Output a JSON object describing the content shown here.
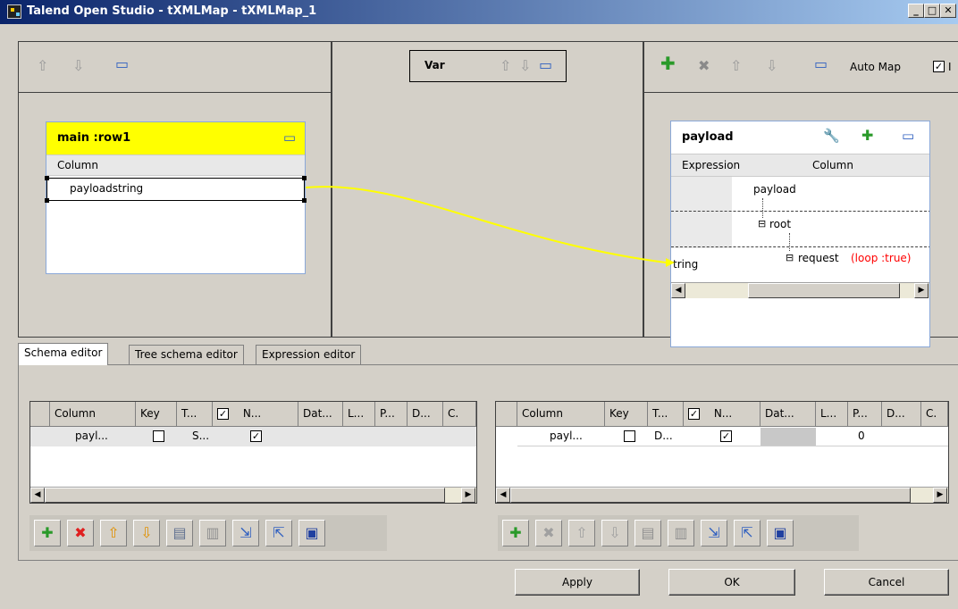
{
  "window": {
    "title": "Talend Open Studio - tXMLMap - tXMLMap_1",
    "minimize": "_",
    "maximize": "□",
    "close": "✕"
  },
  "var_panel": {
    "title": "Var"
  },
  "output_toolbar": {
    "auto_map_label": "Auto Map",
    "toggle_checked": true,
    "toggle_label": "I"
  },
  "input_table": {
    "title": "main :row1",
    "column_header": "Column",
    "rows": [
      "payloadstring"
    ]
  },
  "output_table": {
    "title": "payload",
    "expression_header": "Expression",
    "column_header": "Column",
    "tree": {
      "root_label": "payload",
      "child_label": "root",
      "leaf_label": "request",
      "leaf_annotation": "(loop :true)",
      "leaf_expression": "tring"
    }
  },
  "tabs": [
    {
      "label": "Schema editor",
      "active": true
    },
    {
      "label": "Tree schema editor",
      "active": false
    },
    {
      "label": "Expression editor",
      "active": false
    }
  ],
  "left_grid": {
    "headers": [
      "Column",
      "Key",
      "T...",
      "",
      "N...",
      "Dat...",
      "L...",
      "P...",
      "D...",
      "C."
    ],
    "row": {
      "column": "payl...",
      "key_checked": false,
      "type": "S...",
      "nullable_checked": true
    }
  },
  "right_grid": {
    "headers": [
      "Column",
      "Key",
      "T...",
      "",
      "N...",
      "Dat...",
      "L...",
      "P...",
      "D...",
      "C."
    ],
    "row": {
      "column": "payl...",
      "key_checked": false,
      "type": "D...",
      "nullable_checked": true,
      "precision": "0"
    }
  },
  "buttons": {
    "apply": "Apply",
    "ok": "OK",
    "cancel": "Cancel"
  },
  "icons": {
    "up": "⇧",
    "down": "⇩",
    "window": "▭",
    "plus": "✚",
    "delete": "✖",
    "wrench": "🔧",
    "check": "✓",
    "checkbox_mark": "✓",
    "copy": "▤",
    "paste": "▥",
    "import": "⇲",
    "export": "⇱",
    "save": "▣",
    "tree_minus": "⊟",
    "scroll_left": "◀",
    "scroll_right": "▶"
  },
  "colors": {
    "input_header": "#ffff00",
    "link": "#ffff00",
    "annotation": "#ff0000",
    "title_bar": "#0a246a"
  }
}
